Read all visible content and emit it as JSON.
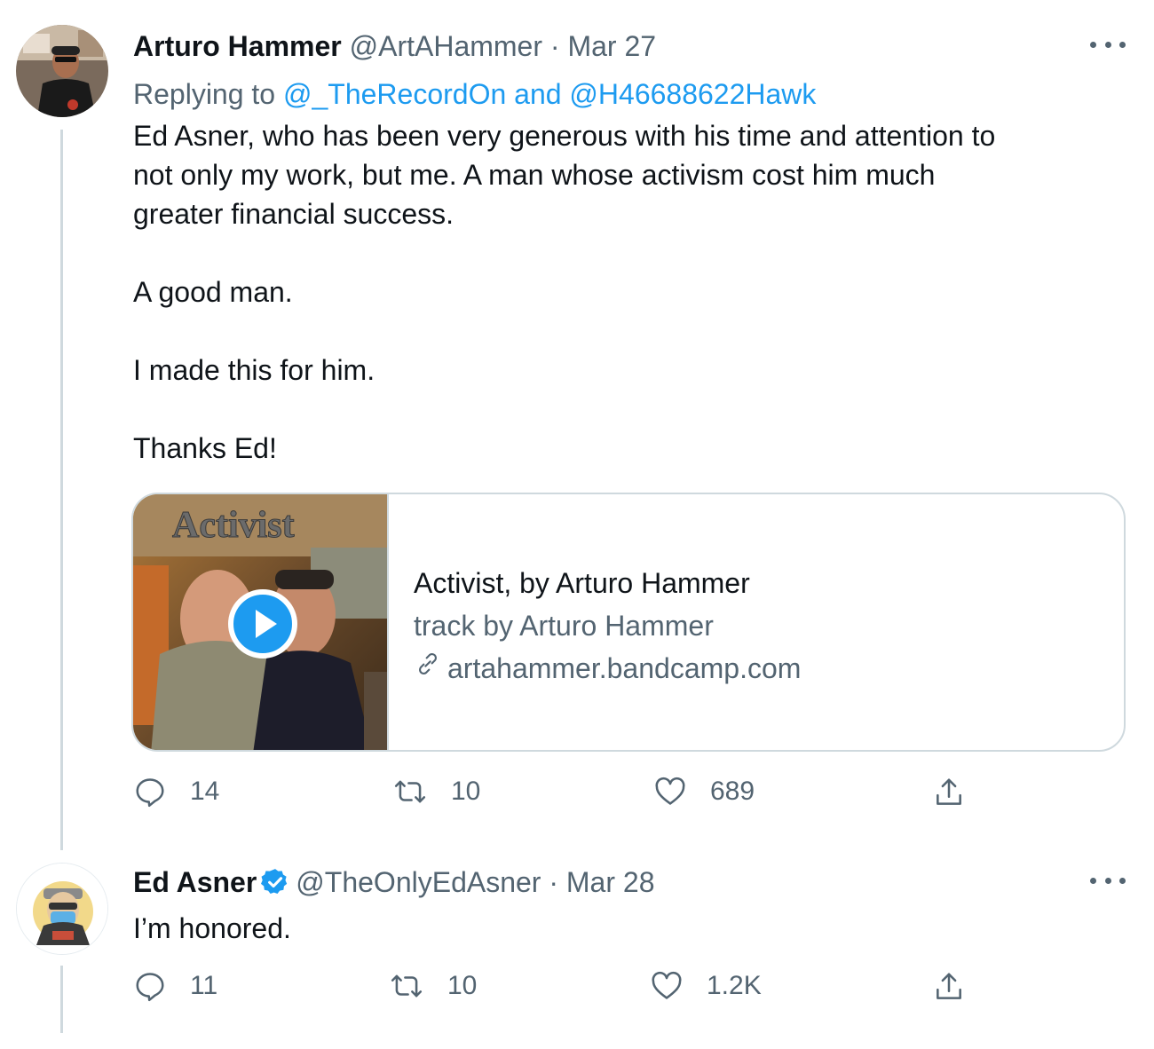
{
  "tweets": [
    {
      "name": "Arturo Hammer",
      "handle": "@ArtAHammer",
      "dot": "·",
      "date": "Mar 27",
      "replying_prefix": "Replying to ",
      "replying_mention1": "@_TheRecordOn",
      "replying_and": " and ",
      "replying_mention2": "@H46688622Hawk",
      "text": [
        "Ed Asner, who has been very generous with his time and attention to",
        "not only my work, but me. A man whose activism cost him much",
        "greater financial success.",
        "",
        "A good man.",
        "",
        "I made this for him.",
        "",
        "Thanks Ed!"
      ],
      "card": {
        "thumb_title": "Activist",
        "title": "Activist, by Arturo Hammer",
        "subtitle": "track by Arturo Hammer",
        "link": "artahammer.bandcamp.com"
      },
      "reply_count": "14",
      "retweet_count": "10",
      "like_count": "689"
    },
    {
      "name": "Ed Asner",
      "verified": true,
      "handle": "@TheOnlyEdAsner",
      "dot": "·",
      "date": "Mar 28",
      "text": "I’m honored.",
      "reply_count": "11",
      "retweet_count": "10",
      "like_count": "1.2K"
    }
  ],
  "colors": {
    "accent": "#1d9bf0",
    "secondary_text": "#536471",
    "primary_text": "#0f1419",
    "border": "#cfd9de"
  },
  "icons": [
    "more-icon",
    "reply-icon",
    "retweet-icon",
    "like-icon",
    "share-icon",
    "verified-badge-icon",
    "link-icon",
    "play-icon"
  ]
}
